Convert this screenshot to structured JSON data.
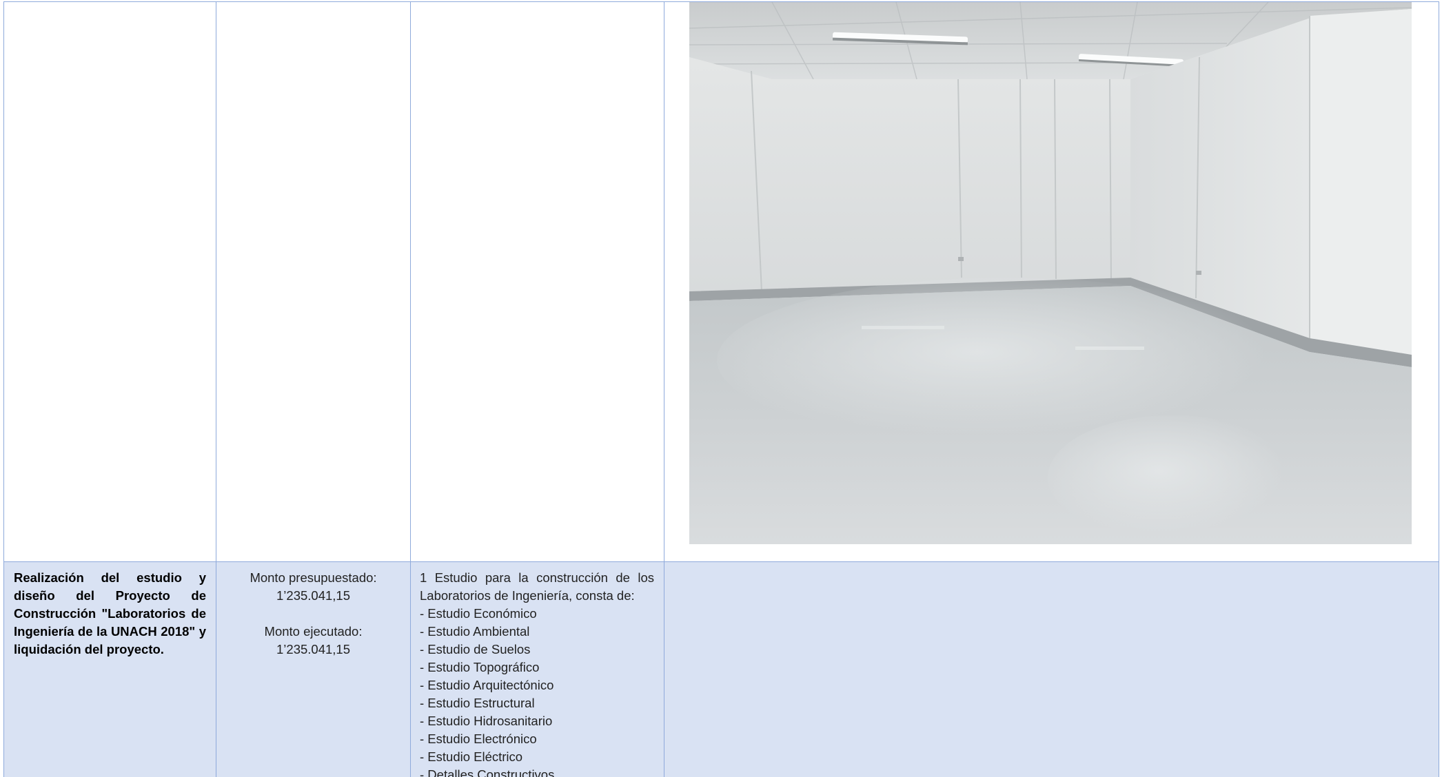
{
  "photo": {
    "alt": "empty laboratory room with white walls, grey epoxy floor and fluorescent ceiling lights",
    "icon": "photo-image"
  },
  "project": {
    "title": "Realización del estudio y diseño del Proyecto de Construcción \"Laboratorios de Ingeniería de la UNACH 2018\" y liquidación del proyecto.",
    "budget_label": "Monto presupuestado:",
    "budget_value": "1’235.041,15",
    "executed_label": "Monto ejecutado:",
    "executed_value": "1’235.041,15",
    "description_intro": "1 Estudio para la construcción de los Laboratorios de Ingeniería, consta de:",
    "studies": [
      "- Estudio Económico",
      "- Estudio Ambiental",
      "- Estudio de Suelos",
      "- Estudio Topográfico",
      "- Estudio Arquitectónico",
      "- Estudio Estructural",
      "- Estudio Hidrosanitario",
      "- Estudio Electrónico",
      "- Estudio Eléctrico",
      "- Detalles Constructivos"
    ]
  },
  "colors": {
    "border": "#8eaadb",
    "row_fill": "#d9e2f3"
  }
}
